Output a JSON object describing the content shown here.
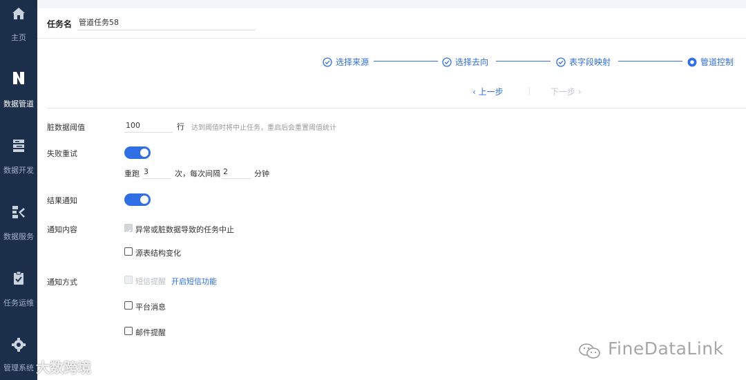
{
  "sidebar": {
    "items": [
      {
        "label": "主页",
        "icon": "home-icon"
      },
      {
        "label": "数据管道",
        "icon": "pipeline-icon",
        "active": true
      },
      {
        "label": "数据开发",
        "icon": "data-dev-icon"
      },
      {
        "label": "数据服务",
        "icon": "data-service-icon"
      },
      {
        "label": "任务运维",
        "icon": "task-ops-icon"
      },
      {
        "label": "管理系统",
        "icon": "gear-icon"
      }
    ]
  },
  "task": {
    "label": "任务名",
    "value": "管道任务58"
  },
  "steps": [
    {
      "label": "选择来源",
      "status": "done"
    },
    {
      "label": "选择去向",
      "status": "done"
    },
    {
      "label": "表字段映射",
      "status": "done"
    },
    {
      "label": "管道控制",
      "status": "current"
    }
  ],
  "step_nav": {
    "prev": "上一步",
    "next": "下一步"
  },
  "form": {
    "dirty_threshold": {
      "label": "脏数据阈值",
      "value": "100",
      "unit": "行",
      "hint": "达到阈值时将中止任务，重启后会重置阈值统计"
    },
    "retry": {
      "label": "失败重试",
      "enabled": true,
      "rerun_label": "重跑",
      "rerun_value": "3",
      "interval_label": "次，每次间隔",
      "interval_value": "2",
      "interval_unit": "分钟"
    },
    "result_notify": {
      "label": "结果通知",
      "enabled": true
    },
    "notify_content": {
      "label": "通知内容",
      "options": [
        {
          "label": "异常或脏数据导致的任务中止",
          "checked": true,
          "disabled": true
        },
        {
          "label": "源表结构变化",
          "checked": false
        }
      ]
    },
    "notify_method": {
      "label": "通知方式",
      "sms_label": "短信提醒",
      "sms_link": "开启短信功能",
      "options": [
        {
          "label": "平台消息",
          "checked": false
        },
        {
          "label": "邮件提醒",
          "checked": false
        }
      ]
    }
  },
  "watermarks": {
    "left": "大数跨境",
    "right": "FineDataLink"
  },
  "colors": {
    "primary": "#2f6ee3",
    "sidebar_bg": "#1b2f4b"
  }
}
